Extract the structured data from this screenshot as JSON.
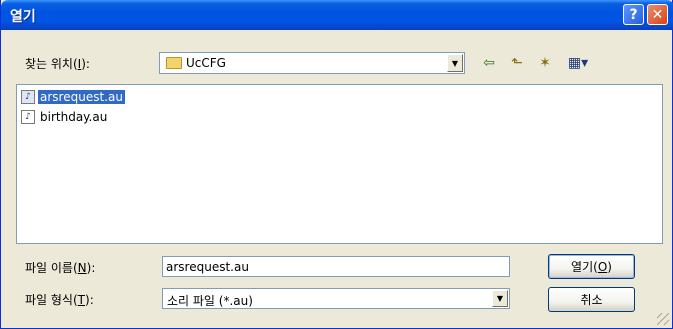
{
  "window": {
    "title": "열기",
    "help_label": "?",
    "close_label": "✕"
  },
  "location": {
    "label_prefix": "찾는 위치(",
    "label_key": "I",
    "label_suffix": "):",
    "value": "UcCFG"
  },
  "toolbar": {
    "back_icon": "⇦",
    "up_icon": "⬑",
    "new_folder_icon": "✶",
    "views_icon": "▦▾"
  },
  "files": [
    {
      "name": "arsrequest.au",
      "selected": true
    },
    {
      "name": "birthday.au",
      "selected": false
    }
  ],
  "filename": {
    "label_prefix": "파일 이름(",
    "label_key": "N",
    "label_suffix": "):",
    "value": "arsrequest.au"
  },
  "filetype": {
    "label_prefix": "파일 형식(",
    "label_key": "T",
    "label_suffix": "):",
    "value": "소리 파일 (*.au)"
  },
  "buttons": {
    "open_prefix": "열기(",
    "open_key": "O",
    "open_suffix": ")",
    "cancel": "취소"
  }
}
